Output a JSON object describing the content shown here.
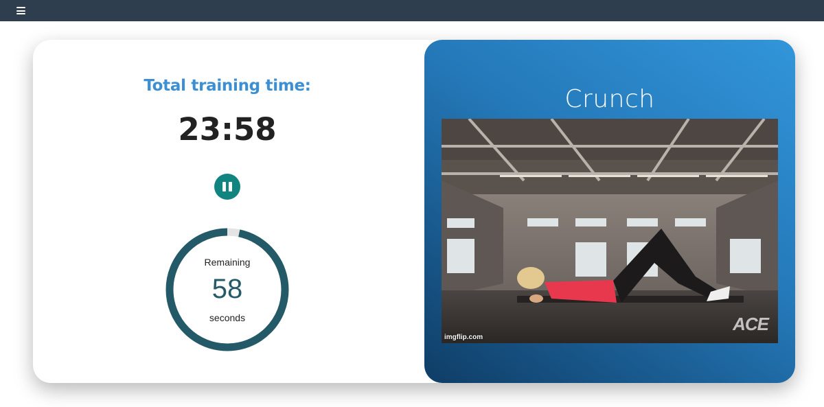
{
  "topbar": {
    "menu_icon": "hamburger-menu-icon"
  },
  "timer": {
    "total_label": "Total training time:",
    "total_time": "23:58",
    "pause_icon": "pause-icon"
  },
  "countdown": {
    "remaining_label": "Remaining",
    "remaining_value": "58",
    "unit_label": "seconds",
    "progress_fraction": 0.967
  },
  "exercise": {
    "name": "Crunch",
    "image_description_icon": "exercise-photo",
    "watermark": "imgflip.com",
    "logo": "ACE"
  },
  "colors": {
    "topbar": "#2e3e4f",
    "accent_blue": "#3d8fd3",
    "pause_button": "#128480",
    "ring": "#245a67",
    "panel_gradient_start": "#3295da",
    "panel_gradient_end": "#0f3d66"
  }
}
